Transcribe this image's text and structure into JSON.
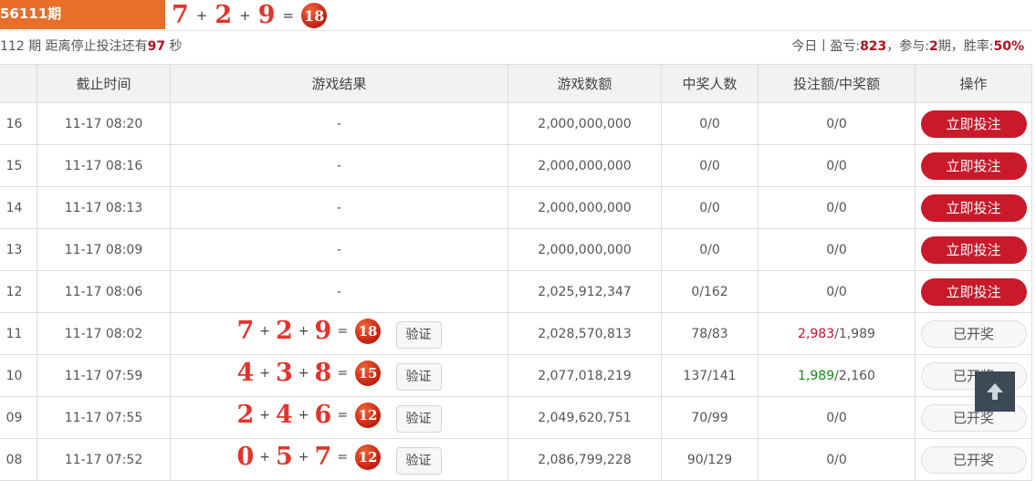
{
  "header": {
    "issue_label": "56111期",
    "formula": {
      "a": "7",
      "b": "2",
      "c": "9",
      "sum": "18",
      "plus": "+",
      "equals": "="
    }
  },
  "infobar": {
    "left": "112 期 距离停止投注还有",
    "countdown": "97",
    "seconds": " 秒",
    "today_prefix": "今日丨盈亏:",
    "profit": "823",
    "participate_prefix": "，参与:",
    "participate": "2",
    "period_suffix": "期，胜率:",
    "win_rate": "50%"
  },
  "table": {
    "headers": [
      "",
      "截止时间",
      "游戏结果",
      "游戏数额",
      "中奖人数",
      "投注额/中奖额",
      "操作"
    ],
    "rows": [
      {
        "issue": "16",
        "time": "11-17 08:20",
        "result": "-",
        "amount": "2,000,000,000",
        "winners": "0/0",
        "bet": "",
        "bet_win": "0/0",
        "action": "立即投注"
      },
      {
        "issue": "15",
        "time": "11-17 08:16",
        "result": "-",
        "amount": "2,000,000,000",
        "winners": "0/0",
        "bet": "",
        "bet_win": "0/0",
        "action": "立即投注"
      },
      {
        "issue": "14",
        "time": "11-17 08:13",
        "result": "-",
        "amount": "2,000,000,000",
        "winners": "0/0",
        "bet": "",
        "bet_win": "0/0",
        "action": "立即投注"
      },
      {
        "issue": "13",
        "time": "11-17 08:09",
        "result": "-",
        "amount": "2,000,000,000",
        "winners": "0/0",
        "bet": "",
        "bet_win": "0/0",
        "action": "立即投注"
      },
      {
        "issue": "12",
        "time": "11-17 08:06",
        "result": "-",
        "amount": "2,025,912,347",
        "winners": "0/162",
        "bet": "",
        "bet_win": "0/0",
        "action": "立即投注"
      },
      {
        "issue": "11",
        "time": "11-17 08:02",
        "n1": "7",
        "n2": "2",
        "n3": "9",
        "sum": "18",
        "verify": "验证",
        "amount": "2,028,570,813",
        "winners": "78/83",
        "bet": "2,983",
        "bet_win": "/1,989",
        "action": "已开奖"
      },
      {
        "issue": "10",
        "time": "11-17 07:59",
        "n1": "4",
        "n2": "3",
        "n3": "8",
        "sum": "15",
        "verify": "验证",
        "amount": "2,077,018,219",
        "winners": "137/141",
        "bet": "1,989",
        "bet_win": "/2,160",
        "action": "已开奖"
      },
      {
        "issue": "09",
        "time": "11-17 07:55",
        "n1": "2",
        "n2": "4",
        "n3": "6",
        "sum": "12",
        "verify": "验证",
        "amount": "2,049,620,751",
        "winners": "70/99",
        "bet": "",
        "bet_win": "0/0",
        "action": "已开奖"
      },
      {
        "issue": "08",
        "time": "11-17 07:52",
        "n1": "0",
        "n2": "5",
        "n3": "7",
        "sum": "12",
        "verify": "验证",
        "amount": "2,086,799,228",
        "winners": "90/129",
        "bet": "",
        "bet_win": "0/0",
        "action": "已开奖"
      }
    ]
  },
  "colors": {
    "tab": "#e76f29",
    "bet_button": "#c81a2b",
    "money": "#b5275a",
    "ball": "#c41e0e",
    "to_top": "#3d4956"
  },
  "icons": {
    "to_top": "arrow-up-icon"
  }
}
